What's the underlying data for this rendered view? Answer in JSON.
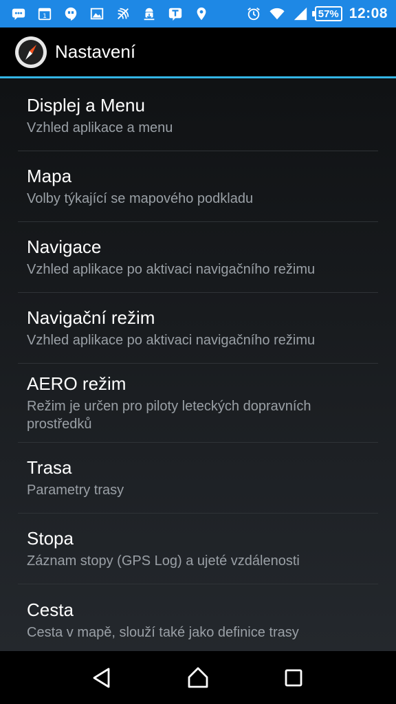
{
  "status_bar": {
    "battery": "57%",
    "time": "12:08",
    "left_icons": [
      "chat-icon",
      "calendar-icon",
      "hangouts-icon",
      "image-icon",
      "nfc-icon",
      "android-download-icon",
      "tapatalk-icon",
      "location-icon"
    ],
    "right_icons": [
      "alarm-icon",
      "wifi-icon",
      "signal-icon",
      "battery-icon"
    ],
    "calendar_day": "1",
    "color": "#1e88e5"
  },
  "action_bar": {
    "title": "Nastavení",
    "accent": "#33b5e5"
  },
  "settings": [
    {
      "title": "Displej a Menu",
      "summary": "Vzhled aplikace a menu"
    },
    {
      "title": "Mapa",
      "summary": "Volby týkající se mapového podkladu"
    },
    {
      "title": "Navigace",
      "summary": "Vzhled aplikace po aktivaci navigačního režimu"
    },
    {
      "title": "Navigační režim",
      "summary": "Vzhled aplikace po aktivaci navigačního režimu"
    },
    {
      "title": "AERO režim",
      "summary": "Režim je určen pro piloty leteckých dopravních prostředků"
    },
    {
      "title": "Trasa",
      "summary": "Parametry trasy"
    },
    {
      "title": "Stopa",
      "summary": "Záznam stopy (GPS Log) a ujeté vzdálenosti"
    },
    {
      "title": "Cesta",
      "summary": "Cesta v mapě, slouží také jako definice trasy"
    }
  ],
  "nav_bar": {
    "buttons": [
      "back-icon",
      "home-icon",
      "recents-icon"
    ]
  }
}
